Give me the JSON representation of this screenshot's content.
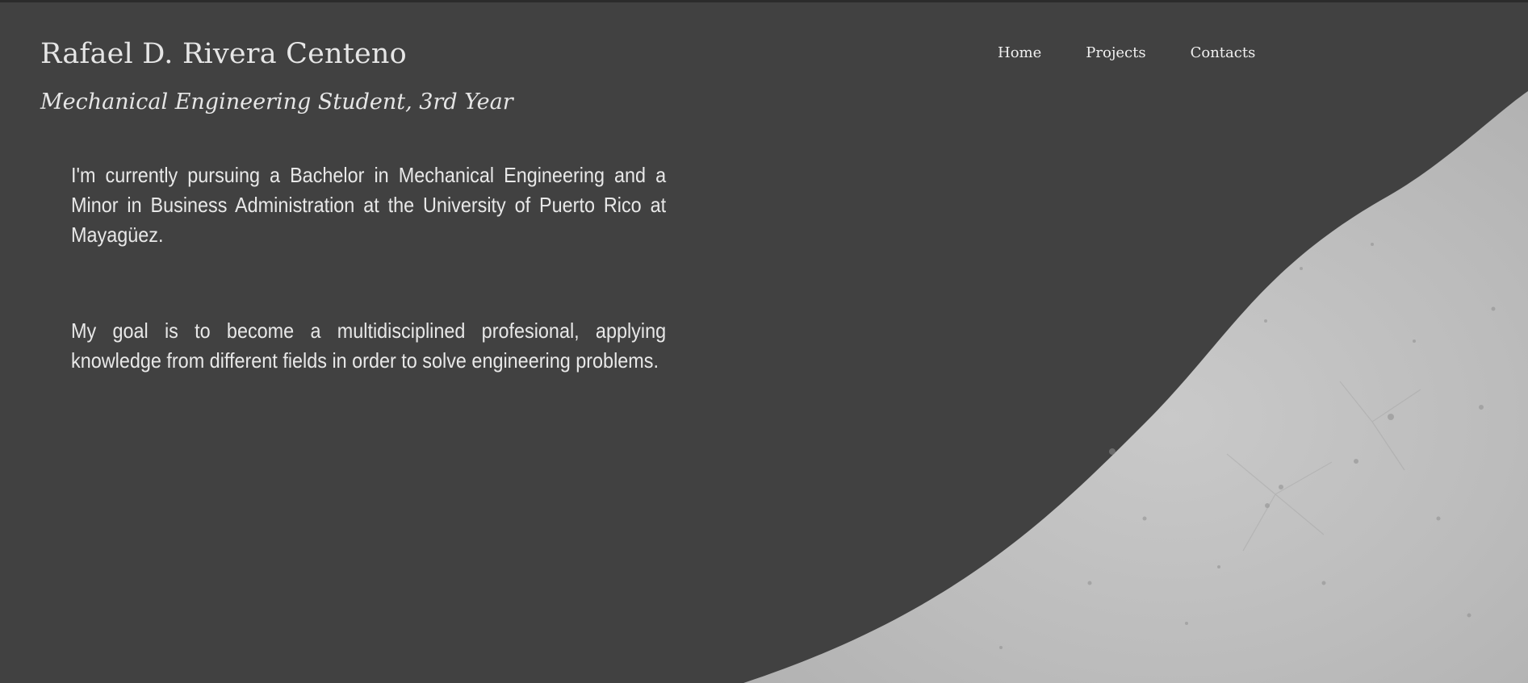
{
  "header": {
    "name": "Rafael D. Rivera Centeno",
    "subtitle": "Mechanical Engineering Student, 3rd Year"
  },
  "nav": {
    "items": [
      {
        "label": "Home"
      },
      {
        "label": "Projects"
      },
      {
        "label": "Contacts"
      }
    ]
  },
  "bio": {
    "paragraph1": "I'm currently pursuing a Bachelor in Mechanical Engineering and a Minor in Business Administration at the University of Puerto Rico at Mayagüez.",
    "paragraph2": "My goal is to become a multidisciplined profesional, applying knowledge from different fields in order to solve engineering problems."
  },
  "colors": {
    "background": "#414141",
    "wave_fill": "#bdbdbd",
    "text": "#e6e6e6"
  }
}
